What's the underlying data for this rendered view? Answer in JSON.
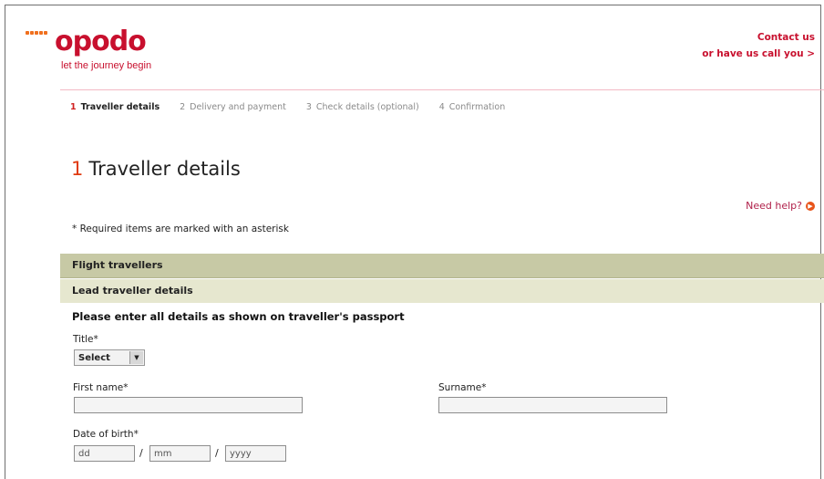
{
  "brand": {
    "name": "opodo",
    "tagline": "let the journey begin",
    "accent_color": "#c8102e",
    "dot_color": "#f0701e"
  },
  "header": {
    "contact_us": "Contact us",
    "call_you": "or have us call you >"
  },
  "steps": [
    {
      "num": "1",
      "label": "Traveller details",
      "active": true
    },
    {
      "num": "2",
      "label": "Delivery and payment",
      "active": false
    },
    {
      "num": "3",
      "label": "Check details (optional)",
      "active": false
    },
    {
      "num": "4",
      "label": "Confirmation",
      "active": false
    }
  ],
  "page": {
    "title_num": "1",
    "title": "Traveller details",
    "help": "Need help?",
    "required_note": "* Required items are marked with an asterisk"
  },
  "sections": {
    "flight_travellers": "Flight travellers",
    "lead_traveller": "Lead traveller details",
    "instruction": "Please enter all details as shown on traveller's passport"
  },
  "form": {
    "title_label": "Title*",
    "title_value": "Select",
    "first_name_label": "First name*",
    "first_name_value": "",
    "surname_label": "Surname*",
    "surname_value": "",
    "dob_label": "Date of birth*",
    "dob_day": "dd",
    "dob_month": "mm",
    "dob_year": "yyyy",
    "separator": "/"
  }
}
